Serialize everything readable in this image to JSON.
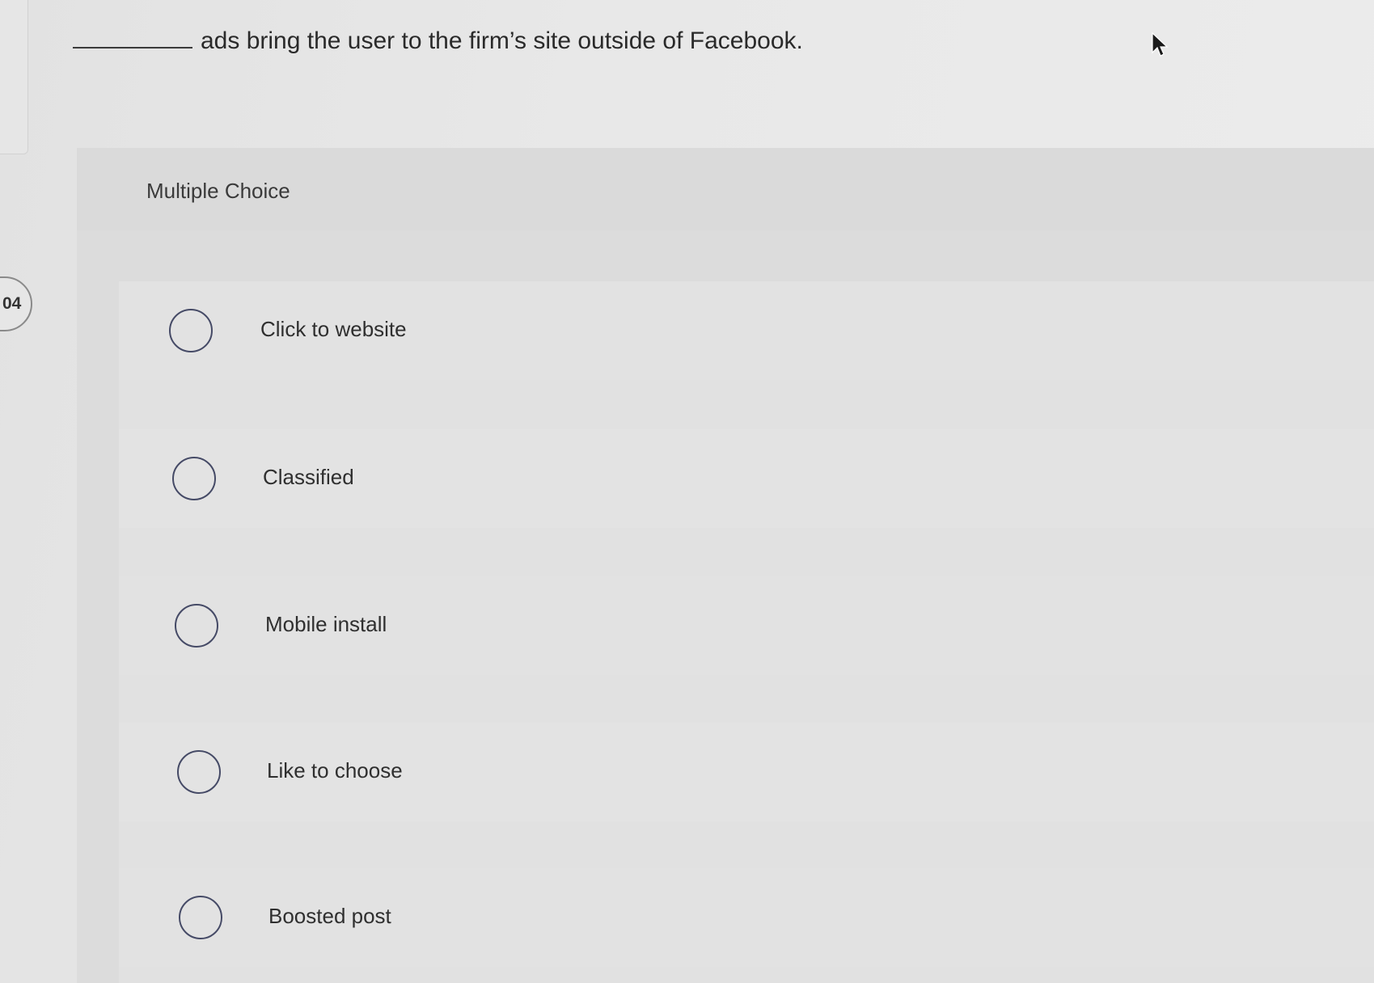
{
  "question": {
    "number": "04",
    "text": "ads bring the user to the firm’s site outside of Facebook."
  },
  "panel": {
    "label": "Multiple Choice"
  },
  "options": [
    {
      "label": "Click to website"
    },
    {
      "label": "Classified"
    },
    {
      "label": "Mobile install"
    },
    {
      "label": "Like to choose"
    },
    {
      "label": "Boosted post"
    }
  ],
  "colors": {
    "background": "#e4e4e4",
    "radio_border": "#454a66",
    "text": "#2b2b2b"
  },
  "icons": {
    "cursor": "mouse-pointer-icon",
    "radio": "radio-circle-icon"
  }
}
